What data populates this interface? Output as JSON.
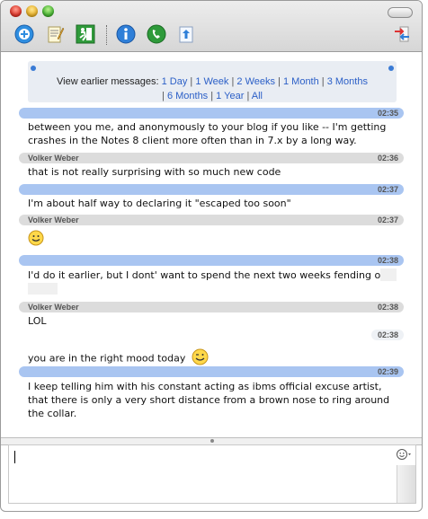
{
  "toolbar": {
    "icons": [
      "add-contact-icon",
      "notepad-icon",
      "exit-icon",
      "info-icon",
      "phone-icon",
      "share-icon",
      "transfer-icon"
    ]
  },
  "history": {
    "prefix": "View earlier messages:",
    "links": [
      "1 Day",
      "1 Week",
      "2 Weeks",
      "1 Month",
      "3 Months",
      "6 Months",
      "1 Year",
      "All"
    ]
  },
  "messages": [
    {
      "sender": "",
      "time": "02:35",
      "text": "between you me, and anonymously to your blog if you like -- I'm getting crashes in the Notes 8 client more often than in 7.x by a long way."
    },
    {
      "sender": "Volker Weber",
      "time": "02:36",
      "text": "that is not really surprising with so much new code"
    },
    {
      "sender": "",
      "time": "02:37",
      "text": "I'm about half way to declaring it \"escaped too soon\""
    },
    {
      "sender": "Volker Weber",
      "time": "02:37",
      "text": ""
    },
    {
      "sender": "",
      "time": "02:38",
      "text": "I'd do it earlier, but I dont' want to spend the next two weeks fending off"
    },
    {
      "sender": "Volker Weber",
      "time": "02:38",
      "text": "LOL"
    },
    {
      "sender": "",
      "time": "02:38",
      "text": "you are in the right mood today"
    },
    {
      "sender": "",
      "time": "02:39",
      "text": "I keep telling him with his constant acting as ibms official excuse artist, that there is only a very short distance from a brown nose to ring around the collar."
    }
  ],
  "colors": {
    "accent": "#2b5fc7",
    "my_header": "#a9c5f1",
    "other_header": "#dcdcdc"
  }
}
